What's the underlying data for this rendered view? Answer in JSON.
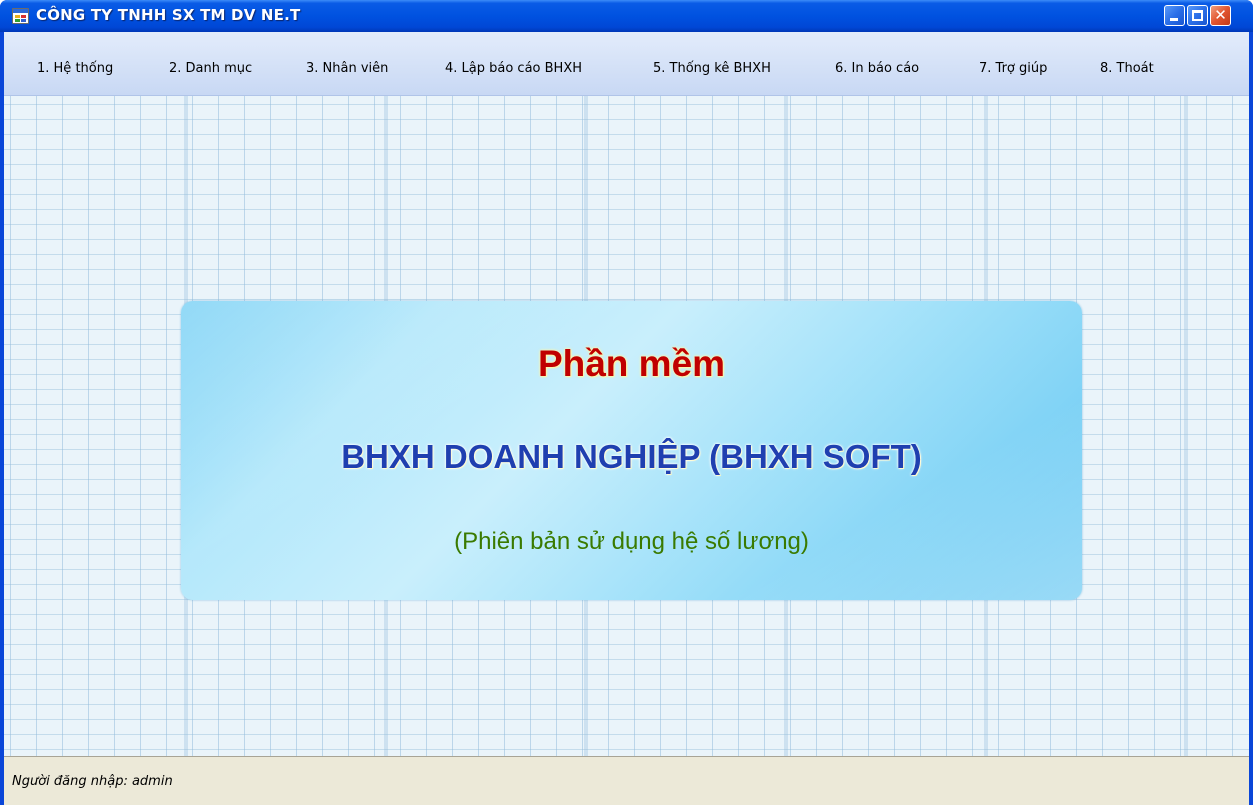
{
  "window": {
    "title": "CÔNG TY TNHH SX TM DV NE.T"
  },
  "menu": {
    "items": [
      {
        "label": "1. Hệ thống"
      },
      {
        "label": "2. Danh mục"
      },
      {
        "label": "3. Nhân viên"
      },
      {
        "label": "4. Lập báo cáo BHXH"
      },
      {
        "label": "5. Thống kê BHXH"
      },
      {
        "label": "6. In báo cáo"
      },
      {
        "label": "7. Trợ giúp"
      },
      {
        "label": "8. Thoát"
      }
    ]
  },
  "banner": {
    "title": "Phần mềm",
    "product": "BHXH DOANH NGHIỆP (BHXH SOFT)",
    "subtitle": "(Phiên bản sử dụng hệ số lương)"
  },
  "status": {
    "text": "Người đăng nhập: admin"
  },
  "icons": {
    "app": "app-window-icon",
    "minimize": "minimize-icon",
    "maximize": "maximize-icon",
    "close": "close-icon"
  },
  "colors": {
    "titlebar": "#0052e0",
    "banner_title": "#c00000",
    "banner_product": "#1f3fb0",
    "banner_subtitle": "#3a7a00"
  }
}
